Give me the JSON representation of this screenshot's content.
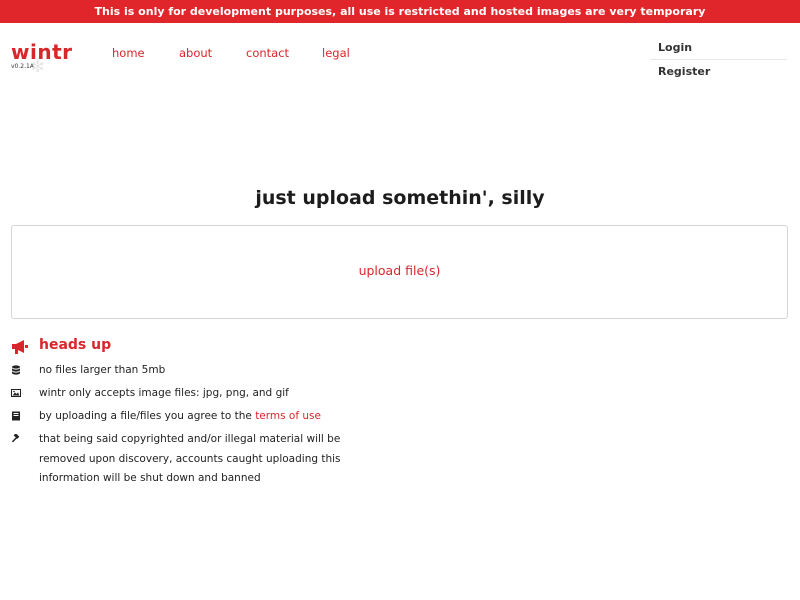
{
  "banner": {
    "text": "This is only for development purposes, all use is restricted and hosted images are very temporary"
  },
  "logo": {
    "name": "wintr",
    "version": "v0.2.1A"
  },
  "nav": {
    "items": [
      "home",
      "about",
      "contact",
      "legal"
    ]
  },
  "account": {
    "login": "Login",
    "register": "Register"
  },
  "main": {
    "headline": "just upload somethin', silly",
    "upload_label": "upload file(s)"
  },
  "heads_up": {
    "title": "heads up",
    "items": [
      {
        "icon": "database-icon",
        "text": "no files larger than 5mb"
      },
      {
        "icon": "image-icon",
        "text": "wintr only accepts image files: jpg, png, and gif"
      },
      {
        "icon": "book-icon",
        "text": "by uploading a file/files you agree to the ",
        "link": "terms of use"
      },
      {
        "icon": "gavel-icon",
        "text": "that being said copyrighted and/or illegal material will be removed upon discovery, accounts caught uploading this information will be shut down and banned"
      }
    ]
  },
  "colors": {
    "brand": "#d9262b",
    "banner_bg": "#e0262b",
    "text": "#222222",
    "border": "#d6d6d6"
  }
}
